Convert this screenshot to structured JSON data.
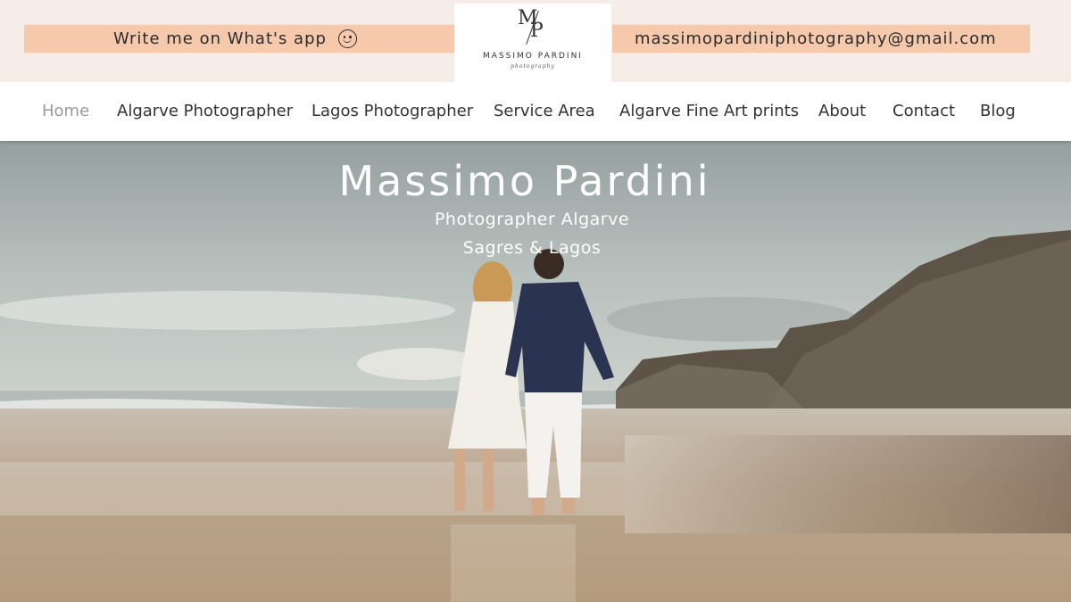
{
  "topbar": {
    "whatsapp_label": "Write me on What's app",
    "whatsapp_icon": "smiley-face-icon",
    "email": "massimopardiniphotography@gmail.com"
  },
  "logo": {
    "monogram_m": "M",
    "monogram_p": "P",
    "name": "MASSIMO PARDINI",
    "tagline": "photography"
  },
  "nav": {
    "items": [
      {
        "label": "Home",
        "active": true
      },
      {
        "label": "Algarve Photographer"
      },
      {
        "label": "Lagos Photographer"
      },
      {
        "label": "Service Area"
      },
      {
        "label": "Algarve Fine Art prints"
      },
      {
        "label": "About"
      },
      {
        "label": "Contact"
      },
      {
        "label": "Blog"
      }
    ]
  },
  "hero": {
    "title": "Massimo Pardini",
    "subtitle_line1": "Photographer Algarve",
    "subtitle_line2": "Sagres & Lagos"
  },
  "colors": {
    "topbar_bg": "#f6ece8",
    "pill_bg": "#f6c9ad",
    "nav_active": "#9a9a9a",
    "nav_text": "#333333"
  }
}
